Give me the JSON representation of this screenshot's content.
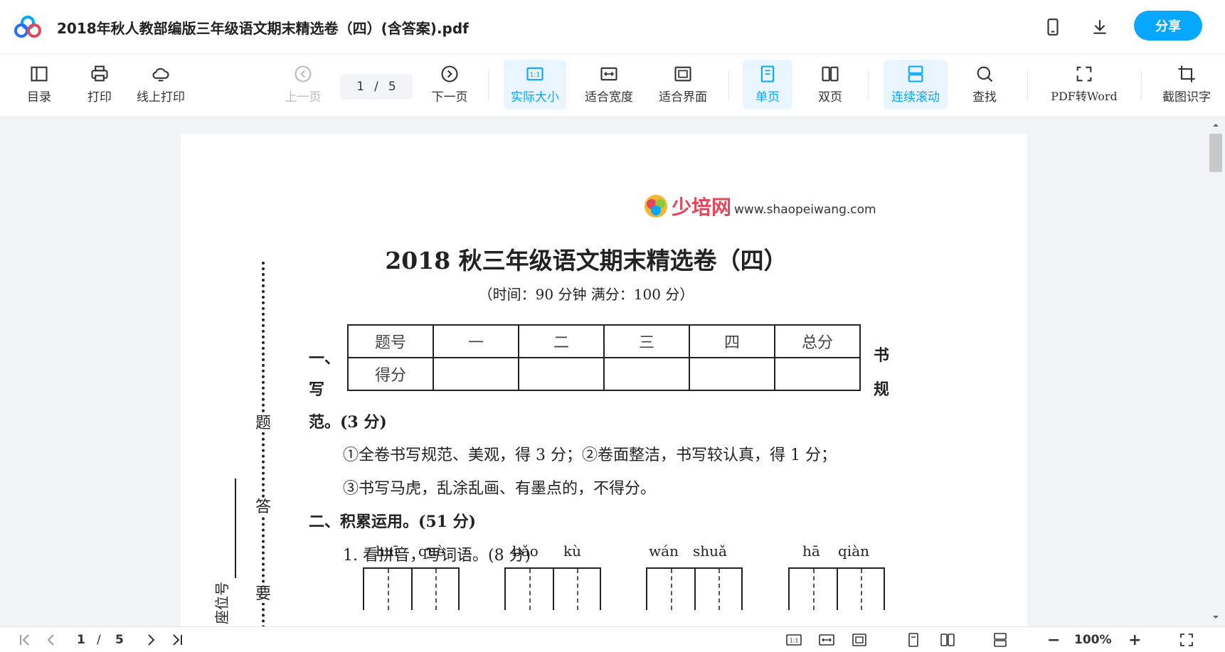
{
  "window": {
    "doc_title": "2018年秋人教部编版三年级语文期末精选卷（四）(含答案).pdf",
    "share_label": "分享"
  },
  "toolbar": {
    "toc": "目录",
    "print": "打印",
    "online_print": "线上打印",
    "prev_page": "上一页",
    "next_page": "下一页",
    "current_page": "1",
    "page_sep": "/",
    "total_pages": "5",
    "actual_size": "实际大小",
    "fit_width": "适合宽度",
    "fit_page": "适合界面",
    "single_page": "单页",
    "double_page": "双页",
    "continuous": "连续滚动",
    "find": "查找",
    "pdf_to_word": "PDF转Word",
    "ocr": "截图识字",
    "actual_size_icon_text": "1:1"
  },
  "document": {
    "brand_cn": "少培网",
    "brand_url": "www.shaopeiwang.com",
    "title": "2018 秋三年级语文期末精选卷（四）",
    "subtitle": "（时间：90 分钟    满分：100 分）",
    "table": {
      "headers": [
        "题号",
        "一",
        "二",
        "三",
        "四",
        "总分"
      ],
      "row_label": "得分"
    },
    "side_left_1": "一、",
    "side_left_2": "写",
    "side_right_1": "书",
    "side_right_2": "规",
    "section1_title": "范。(3 分)",
    "section1_line1": "①全卷书写规范、美观，得 3 分；②卷面整洁，书写较认真，得 1 分；",
    "section1_line2": "③书写马虎，乱涂乱画、有墨点的，不得分。",
    "section2_title": "二、积累运用。(51 分)",
    "q1": "1. 看拼音，写词语。(8 分)",
    "margin_labels": [
      "题",
      "答",
      "要"
    ],
    "seat_label": "座位号",
    "pinyin": [
      [
        "huī",
        "què"
      ],
      [
        "bǎo",
        "kù"
      ],
      [
        "wán",
        "shuǎ"
      ],
      [
        "hā",
        "qiàn"
      ]
    ]
  },
  "statusbar": {
    "current_page": "1",
    "page_sep": "/",
    "total_pages": "5",
    "zoom": "100%",
    "zoom_out": "−",
    "zoom_in": "+",
    "actual_size_icon_text": "1:1"
  },
  "colors": {
    "accent": "#06a7ff",
    "active_bg": "#eaf6ff",
    "brand_red": "#e2485b"
  }
}
